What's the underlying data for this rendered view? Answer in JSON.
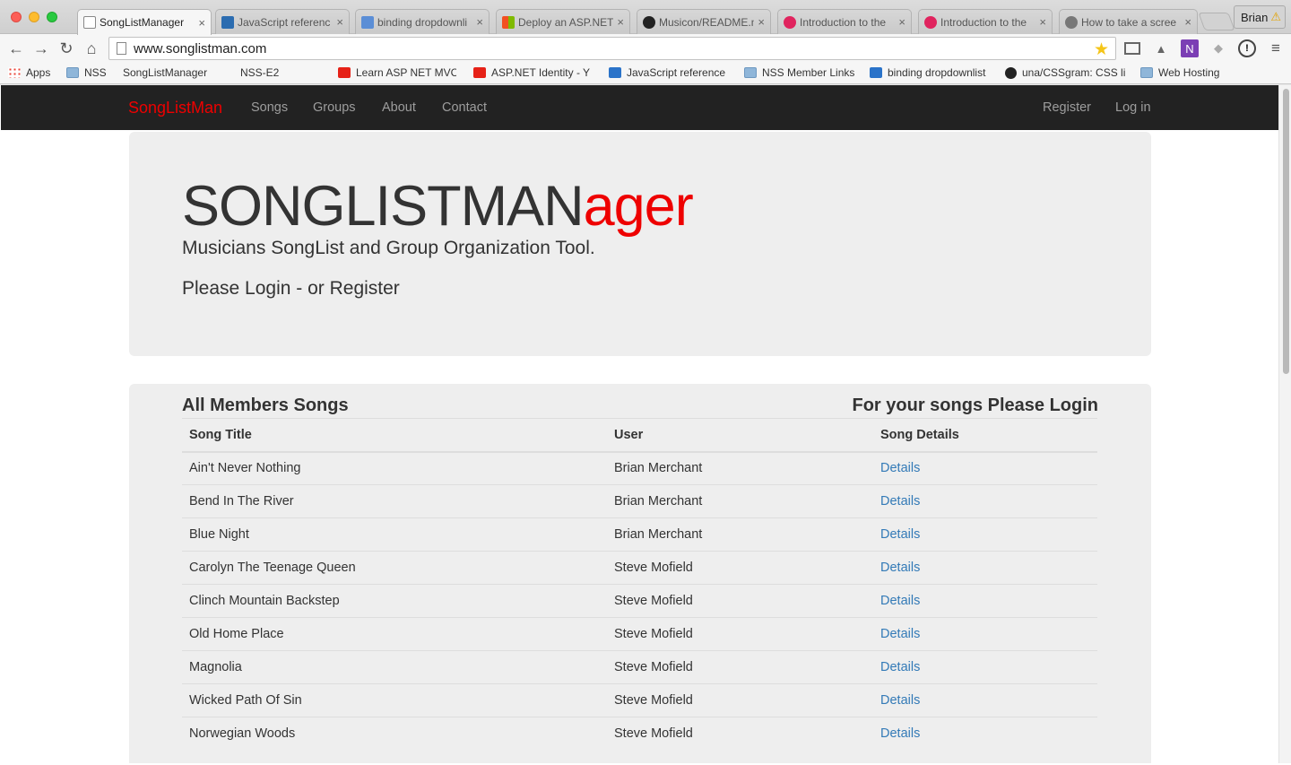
{
  "browser": {
    "tabs": [
      {
        "label": "SongListManager",
        "icon": "page-icon"
      },
      {
        "label": "JavaScript referenc",
        "icon": "mdn-icon"
      },
      {
        "label": "binding dropdownli",
        "icon": "so-icon"
      },
      {
        "label": "Deploy an ASP.NET",
        "icon": "windows-icon"
      },
      {
        "label": "Musicon/README.m",
        "icon": "github-icon"
      },
      {
        "label": "Introduction to the",
        "icon": "treehouse-icon"
      },
      {
        "label": "Introduction to the",
        "icon": "treehouse-icon"
      },
      {
        "label": "How to take a scree",
        "icon": "apple-icon"
      }
    ],
    "profile_name": "Brian",
    "url": "www.songlistman.com",
    "bookmarks": [
      "Apps",
      "NSS",
      "SongListManager",
      "NSS-E2",
      "Learn ASP NET MVC",
      "ASP.NET Identity - Y",
      "JavaScript reference",
      "NSS Member Links",
      "binding dropdownlist",
      "una/CSSgram: CSS li",
      "Web Hosting"
    ]
  },
  "navbar": {
    "brand": "SongListMan",
    "links": [
      "Songs",
      "Groups",
      "About",
      "Contact"
    ],
    "register": "Register",
    "login": "Log in"
  },
  "hero": {
    "title_dark": "SONGLISTMAN",
    "title_red": "ager",
    "subtitle": "Musicians SongList and Group Organization Tool.",
    "login_prompt": "Please Login - or Register"
  },
  "songs_panel": {
    "title": "All Members Songs",
    "right_note": "For your songs Please Login",
    "columns": [
      "Song Title",
      "User",
      "Song Details"
    ],
    "rows": [
      {
        "title": "Ain't Never Nothing",
        "user": "Brian Merchant",
        "link": "Details"
      },
      {
        "title": "Bend In The River",
        "user": "Brian Merchant",
        "link": "Details"
      },
      {
        "title": "Blue Night",
        "user": "Brian Merchant",
        "link": "Details"
      },
      {
        "title": "Carolyn The Teenage Queen",
        "user": "Steve Mofield",
        "link": "Details"
      },
      {
        "title": "Clinch Mountain Backstep",
        "user": "Steve Mofield",
        "link": "Details"
      },
      {
        "title": "Old Home Place",
        "user": "Steve Mofield",
        "link": "Details"
      },
      {
        "title": "Magnolia",
        "user": "Steve Mofield",
        "link": "Details"
      },
      {
        "title": "Wicked Path Of Sin",
        "user": "Steve Mofield",
        "link": "Details"
      },
      {
        "title": "Norwegian Woods",
        "user": "Steve Mofield",
        "link": "Details"
      }
    ]
  },
  "colors": {
    "brand_red": "#ee0000",
    "navbar_bg": "#222222",
    "link_blue": "#337ab7",
    "panel_bg": "#eeeeee"
  }
}
